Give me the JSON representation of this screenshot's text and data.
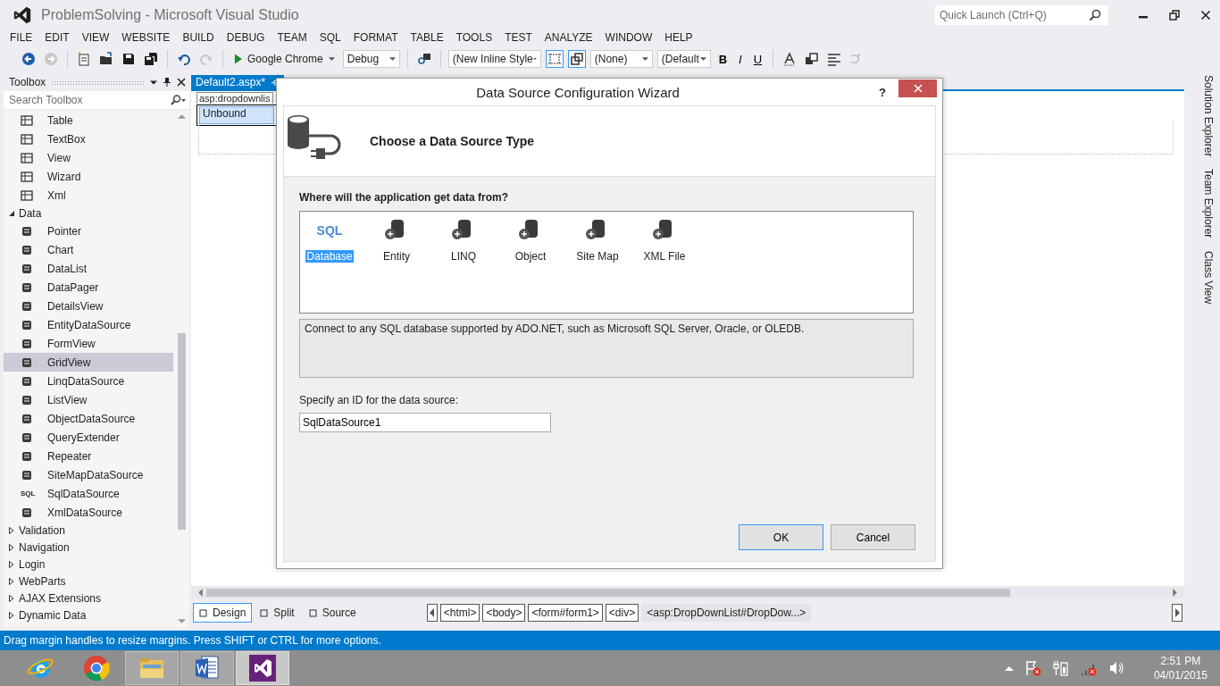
{
  "window": {
    "title": "ProblemSolving - Microsoft Visual Studio"
  },
  "quick_launch": {
    "placeholder": "Quick Launch (Ctrl+Q)"
  },
  "menu": [
    "FILE",
    "EDIT",
    "VIEW",
    "WEBSITE",
    "BUILD",
    "DEBUG",
    "TEAM",
    "SQL",
    "FORMAT",
    "TABLE",
    "TOOLS",
    "TEST",
    "ANALYZE",
    "WINDOW",
    "HELP"
  ],
  "toolbar": {
    "run_target": "Google Chrome",
    "configuration": "Debug",
    "style": "(New Inline Style",
    "target_rule": "(None)",
    "font": "(Default",
    "format_buttons": [
      "B",
      "I",
      "U"
    ]
  },
  "toolbox": {
    "title": "Toolbox",
    "search_placeholder": "Search Toolbox",
    "items": [
      {
        "kind": "item",
        "label": "Table",
        "selected": false
      },
      {
        "kind": "item",
        "label": "TextBox",
        "selected": false
      },
      {
        "kind": "item",
        "label": "View",
        "selected": false
      },
      {
        "kind": "item",
        "label": "Wizard",
        "selected": false
      },
      {
        "kind": "item",
        "label": "Xml",
        "selected": false
      },
      {
        "kind": "group",
        "label": "Data",
        "expanded": true,
        "children": [
          {
            "label": "Pointer",
            "selected": false
          },
          {
            "label": "Chart",
            "selected": false
          },
          {
            "label": "DataList",
            "selected": false
          },
          {
            "label": "DataPager",
            "selected": false
          },
          {
            "label": "DetailsView",
            "selected": false
          },
          {
            "label": "EntityDataSource",
            "selected": false
          },
          {
            "label": "FormView",
            "selected": false
          },
          {
            "label": "GridView",
            "selected": true
          },
          {
            "label": "LinqDataSource",
            "selected": false
          },
          {
            "label": "ListView",
            "selected": false
          },
          {
            "label": "ObjectDataSource",
            "selected": false
          },
          {
            "label": "QueryExtender",
            "selected": false
          },
          {
            "label": "Repeater",
            "selected": false
          },
          {
            "label": "SiteMapDataSource",
            "selected": false
          },
          {
            "label": "SqlDataSource",
            "selected": false,
            "icon_text": "SQL"
          },
          {
            "label": "XmlDataSource",
            "selected": false
          }
        ]
      },
      {
        "kind": "group",
        "label": "Validation",
        "expanded": false
      },
      {
        "kind": "group",
        "label": "Navigation",
        "expanded": false
      },
      {
        "kind": "group",
        "label": "Login",
        "expanded": false
      },
      {
        "kind": "group",
        "label": "WebParts",
        "expanded": false
      },
      {
        "kind": "group",
        "label": "AJAX Extensions",
        "expanded": false
      },
      {
        "kind": "group",
        "label": "Dynamic Data",
        "expanded": false
      }
    ]
  },
  "editor": {
    "tab": "Default2.aspx*",
    "element_tag": "asp:dropdownlis",
    "dropdown_value": "Unbound",
    "views": [
      {
        "label": "Design",
        "selected": true
      },
      {
        "label": "Split",
        "selected": false
      },
      {
        "label": "Source",
        "selected": false
      }
    ],
    "breadcrumbs": [
      "<html>",
      "<body>",
      "<form#form1>",
      "<div>",
      "<asp:DropDownList#DropDow...>"
    ]
  },
  "side_tabs": [
    "Solution Explorer",
    "Team Explorer",
    "Class View"
  ],
  "status_bar": "Drag margin handles to resize margins. Press SHIFT or CTRL for more options.",
  "dialog": {
    "title": "Data Source Configuration Wizard",
    "help": "?",
    "heading": "Choose a Data Source Type",
    "question": "Where will the application get data from?",
    "sources": [
      {
        "label": "Database",
        "selected": true,
        "icon_text": "SQL"
      },
      {
        "label": "Entity",
        "selected": false
      },
      {
        "label": "LINQ",
        "selected": false
      },
      {
        "label": "Object",
        "selected": false
      },
      {
        "label": "Site Map",
        "selected": false
      },
      {
        "label": "XML File",
        "selected": false
      }
    ],
    "description": "Connect to any SQL database supported by ADO.NET, such as Microsoft SQL Server, Oracle, or OLEDB.",
    "id_label": "Specify an ID for the data source:",
    "id_value": "SqlDataSource1",
    "buttons": [
      "OK",
      "Cancel"
    ]
  },
  "taskbar": {
    "apps": [
      {
        "kind": "ie",
        "selected": false
      },
      {
        "kind": "chrome",
        "selected": false
      },
      {
        "kind": "explorer",
        "selected": false
      },
      {
        "kind": "word",
        "selected": false
      },
      {
        "kind": "vs",
        "selected": true
      }
    ],
    "time": "2:51 PM",
    "date": "04/01/2015"
  }
}
